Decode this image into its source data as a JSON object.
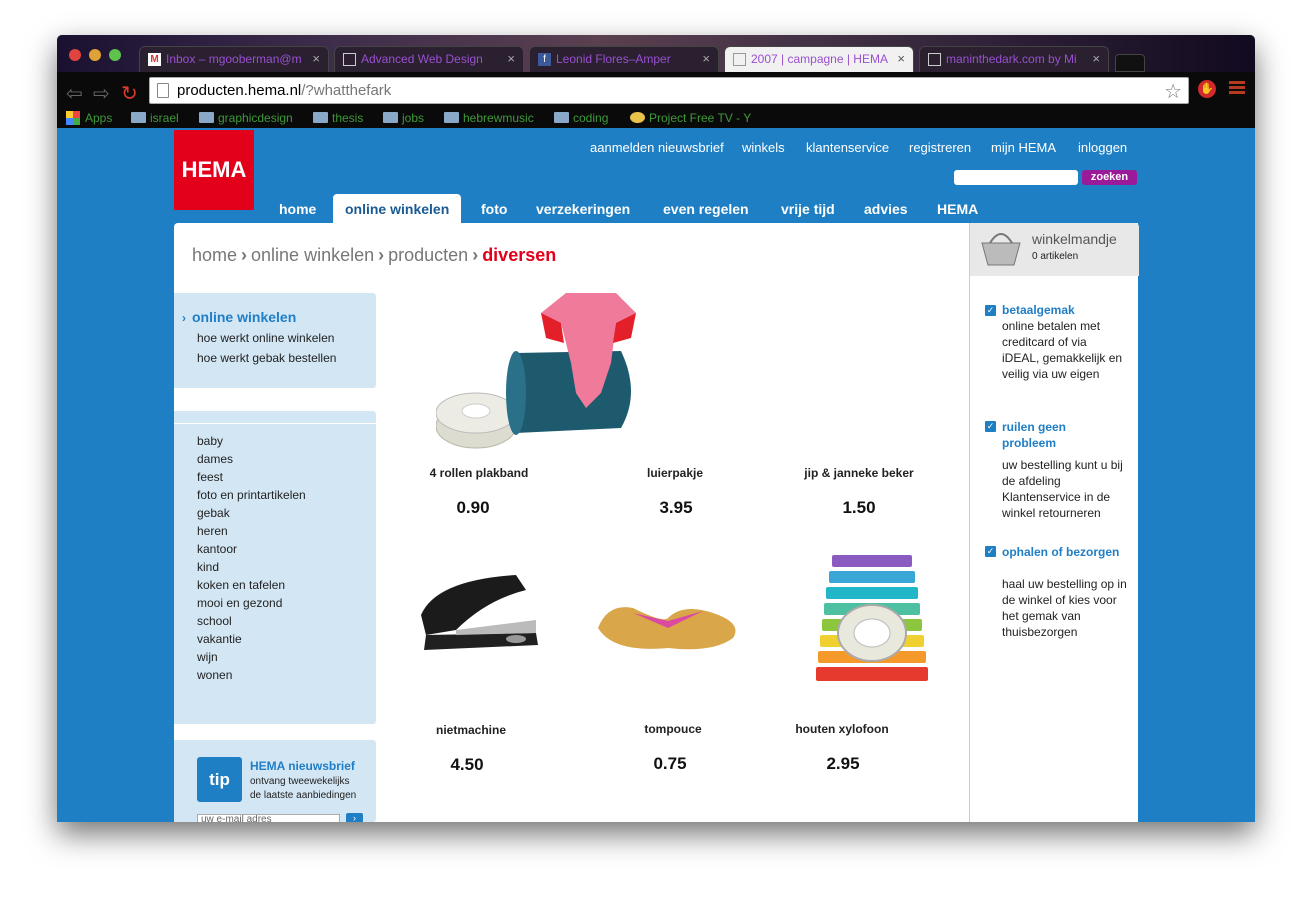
{
  "browser": {
    "tabs": [
      {
        "label": "Inbox – mgooberman@m",
        "icon": "gmail-icon"
      },
      {
        "label": "Advanced Web Design",
        "icon": "page-icon"
      },
      {
        "label": "Leonid Flores–Amper",
        "icon": "facebook-icon"
      },
      {
        "label": "2007 | campagne | HEMA",
        "icon": "page-icon"
      },
      {
        "label": "maninthedark.com by Mi",
        "icon": "page-icon"
      }
    ],
    "url_host": "producten.hema.nl",
    "url_path": "/?whatthefark",
    "bookmarks": [
      "Apps",
      "israel",
      "graphicdesign",
      "thesis",
      "jobs",
      "hebrewmusic",
      "coding",
      "Project Free TV - Y"
    ]
  },
  "header": {
    "logo": "HEMA",
    "top_links": [
      "aanmelden nieuwsbrief",
      "winkels",
      "klantenservice",
      "registreren",
      "mijn HEMA",
      "inloggen"
    ],
    "search_button": "zoeken",
    "nav": [
      "home",
      "online winkelen",
      "foto",
      "verzekeringen",
      "even regelen",
      "vrije tijd",
      "advies",
      "HEMA"
    ],
    "active_nav": "online winkelen"
  },
  "breadcrumb": {
    "items": [
      "home",
      "online winkelen",
      "producten"
    ],
    "current": "diversen"
  },
  "sidebar": {
    "title": "online winkelen",
    "sub_links": [
      "hoe werkt online winkelen",
      "hoe werkt gebak bestellen"
    ],
    "categories": [
      "baby",
      "dames",
      "feest",
      "foto en printartikelen",
      "gebak",
      "heren",
      "kantoor",
      "kind",
      "koken en tafelen",
      "mooi en gezond",
      "school",
      "vakantie",
      "wijn",
      "wonen"
    ],
    "tip": {
      "badge": "tip",
      "title": "HEMA nieuwsbrief",
      "line1": "ontvang tweewekelijks",
      "line2": "de laatste aanbiedingen",
      "email_placeholder": "uw e-mail adres"
    }
  },
  "products": [
    {
      "name": "4 rollen plakband",
      "price": "0.90"
    },
    {
      "name": "luierpakje",
      "price": "3.95"
    },
    {
      "name": "jip & janneke beker",
      "price": "1.50"
    },
    {
      "name": "nietmachine",
      "price": "4.50"
    },
    {
      "name": "tompouce",
      "price": "0.75"
    },
    {
      "name": "houten xylofoon",
      "price": "2.95"
    }
  ],
  "cart": {
    "title": "winkelmandje",
    "count": "0 artikelen"
  },
  "usps": [
    {
      "title": "betaalgemak",
      "text": "online betalen met creditcard of via iDEAL, gemakkelijk en veilig via uw eigen"
    },
    {
      "title": "ruilen geen probleem",
      "text": "uw bestelling kunt u bij de afdeling Klantenservice in de winkel retourneren"
    },
    {
      "title": "ophalen of bezorgen",
      "text": "haal uw bestelling op in de winkel of kies voor het gemak van thuisbezorgen"
    }
  ],
  "colors": {
    "brand_red": "#e3001b",
    "brand_blue": "#1e7fc4",
    "search_purple": "#9a1a9a"
  }
}
